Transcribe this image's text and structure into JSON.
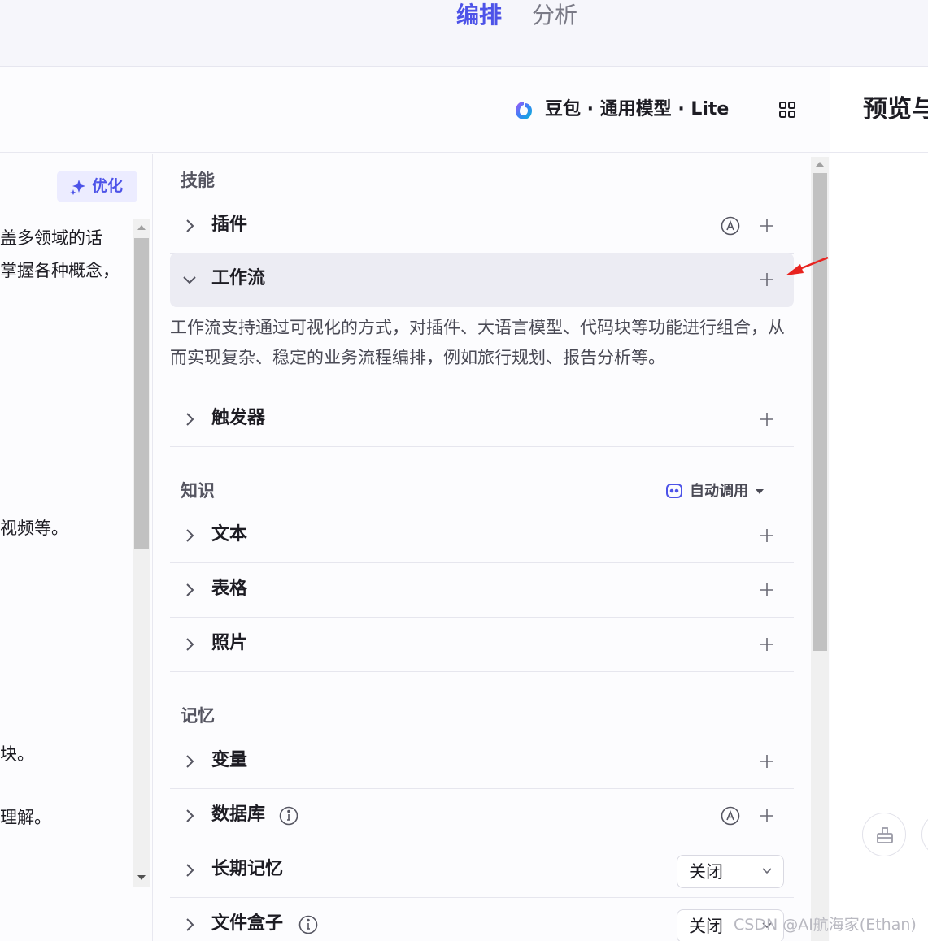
{
  "tabs": {
    "active": "编排",
    "inactive": "分析"
  },
  "model": {
    "name": "豆包 · 通用模型 · Lite"
  },
  "preview": {
    "title": "预览与"
  },
  "prompt": {
    "optimize_label": "优化",
    "lines": [
      "盖多领域的话",
      "掌握各种概念，",
      "视频等。",
      "块。",
      "理解。"
    ]
  },
  "skills": {
    "title": "技能",
    "plugin": "插件",
    "workflow": "工作流",
    "workflow_desc": "工作流支持通过可视化的方式，对插件、大语言模型、代码块等功能进行组合，从而实现复杂、稳定的业务流程编排，例如旅行规划、报告分析等。",
    "trigger": "触发器"
  },
  "knowledge": {
    "title": "知识",
    "auto_call": "自动调用",
    "text": "文本",
    "table": "表格",
    "photo": "照片"
  },
  "memory": {
    "title": "记忆",
    "variable": "变量",
    "database": "数据库",
    "long_term": "长期记忆",
    "long_term_value": "关闭",
    "filebox": "文件盒子",
    "filebox_value": "关闭"
  },
  "watermark": "CSDN @AI航海家(Ethan)",
  "colors": {
    "accent": "#4d53e8",
    "annotation_arrow": "#e8231f"
  }
}
